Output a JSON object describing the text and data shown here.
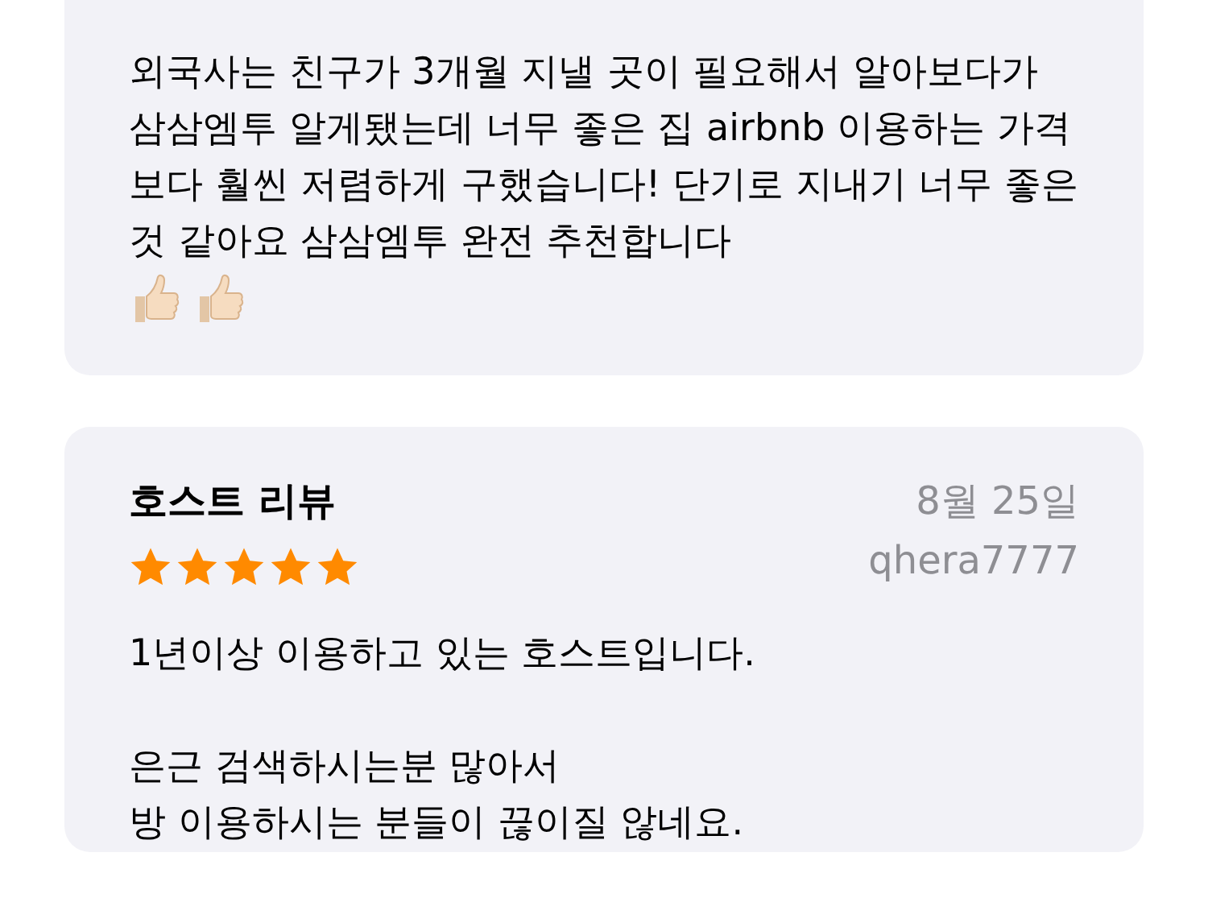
{
  "reviews": [
    {
      "body": [
        "외국사는 친구가 3개월 지낼 곳이 필요해서 알아보다가 삼삼엠투 알게됐는데 너무 좋은 집 airbnb 이용하는 가격 보다 훨씬 저렴하게 구했습니다! 단기로 지내기 너무 좋은 것 같아요 삼삼엠투 완전 추천합니다"
      ],
      "kind": "continued"
    },
    {
      "title": "호스트 리뷰",
      "date": "8월 25일",
      "stars": 5,
      "author": "qhera7777",
      "body": [
        "1년이상 이용하고 있는 호스트입니다.",
        "은근 검색하시는분 많아서\n방 이용하시는 분들이 끊이질 않네요."
      ],
      "kind": "full"
    }
  ]
}
